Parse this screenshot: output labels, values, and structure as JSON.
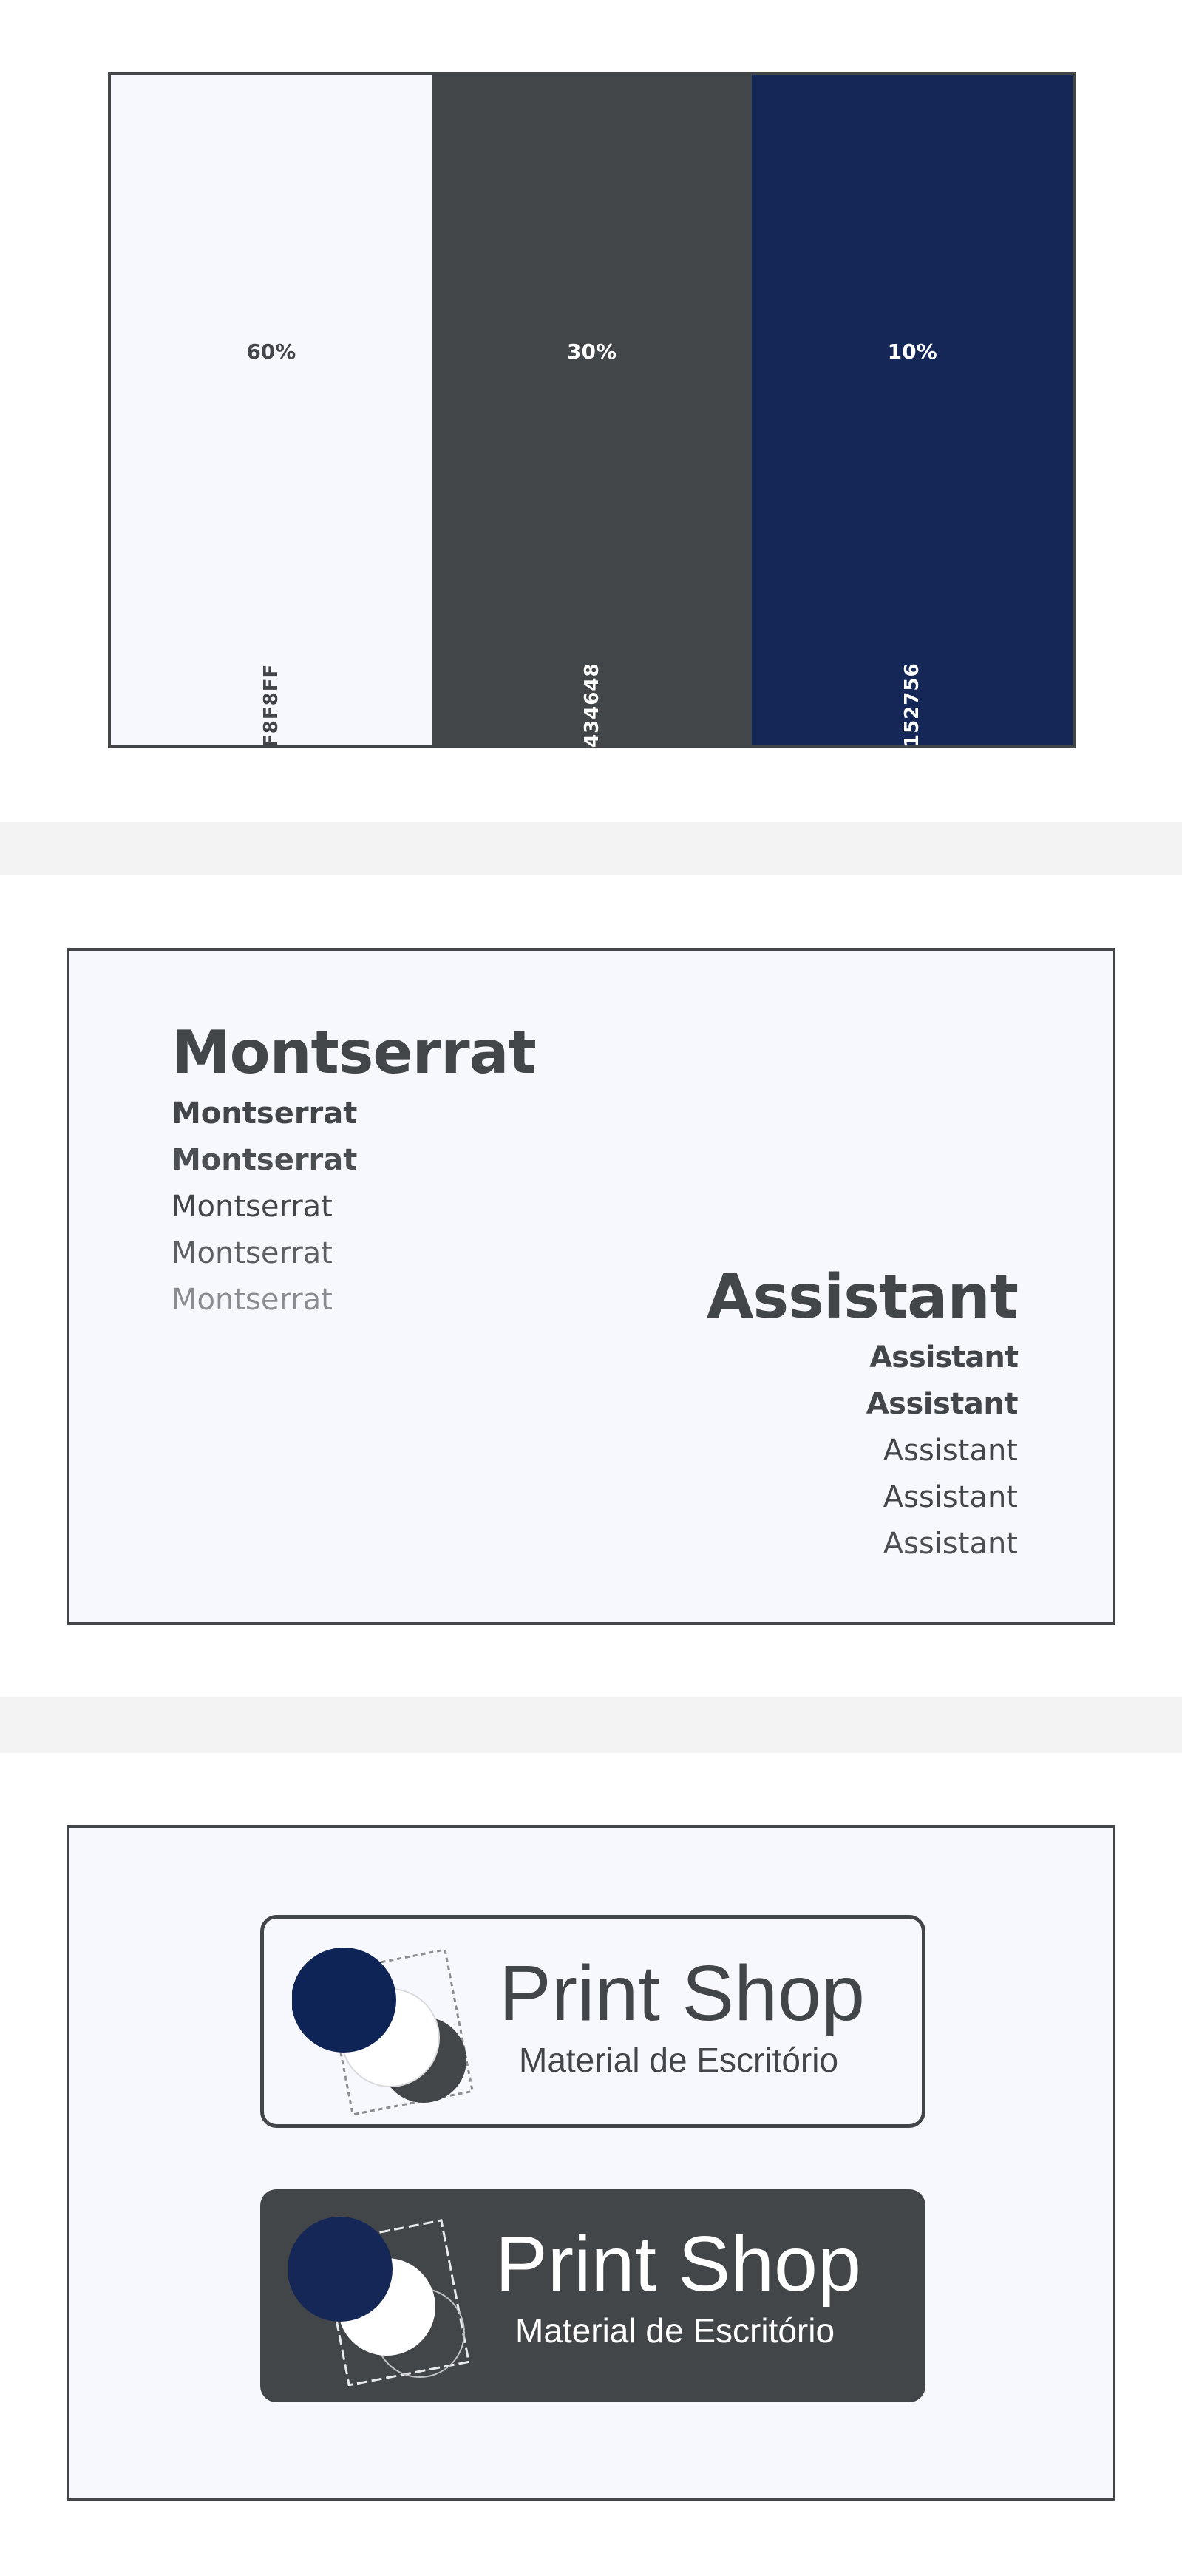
{
  "palette": {
    "swatches": [
      {
        "percent": "60%",
        "hex": "F8F8FF",
        "color": "#f7f8fd",
        "text_color": "#434648"
      },
      {
        "percent": "30%",
        "hex": "434648",
        "color": "#434648",
        "text_color": "#ffffff"
      },
      {
        "percent": "10%",
        "hex": "152756",
        "color": "#152756",
        "text_color": "#ffffff"
      }
    ]
  },
  "typography": {
    "primary": {
      "heading": "Montserrat",
      "weights": [
        "Montserrat",
        "Montserrat",
        "Montserrat",
        "Montserrat"
      ],
      "last": "Montserrat"
    },
    "secondary": {
      "heading": "Assistant",
      "weights": [
        "Assistant",
        "Assistant",
        "Assistant",
        "Assistant",
        "Assistant"
      ]
    }
  },
  "logos": {
    "light": {
      "title": "Print Shop",
      "subtitle": "Material de Escritório",
      "text_color": "#434648"
    },
    "dark": {
      "title": "Print Shop",
      "subtitle": "Material de Escritório",
      "text_color": "#ffffff"
    }
  },
  "colors": {
    "frame": "#434648",
    "navy": "#152756",
    "navy_dark": "#0f2456",
    "separator": "#f3f3f3",
    "panel": "#f7f8fd"
  }
}
